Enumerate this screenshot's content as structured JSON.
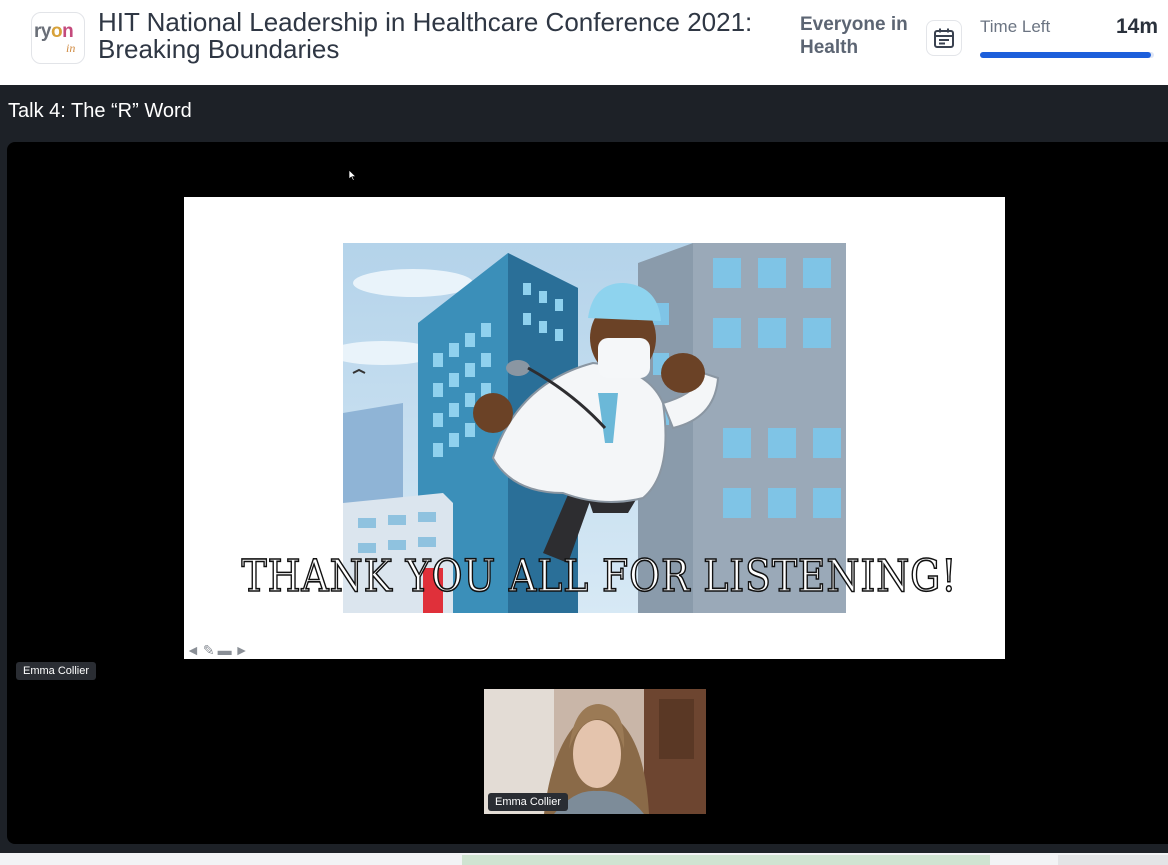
{
  "header": {
    "logo_text": "ryon",
    "logo_sub": "in",
    "conference_title": "HIT National Leadership in Healthcare Conference 2021: Breaking Boundaries",
    "channel_name": "Everyone in Health",
    "calendar_icon": "calendar-icon",
    "time_left_label": "Time Left",
    "time_left_value": "14m",
    "time_left_progress": 0.98
  },
  "talk": {
    "title": "Talk 4: The “R” Word"
  },
  "slide": {
    "caption": "THANK YOU ALL FOR LISTENING!",
    "tool_icons": [
      "prev-arrow-icon",
      "pen-icon",
      "screen-icon",
      "next-arrow-icon"
    ]
  },
  "participants": {
    "presenter_tag": "Emma Collier",
    "video_tag": "Emma Collier"
  },
  "colors": {
    "accent": "#1d5fdb",
    "stage_bg": "#000000",
    "app_bg": "#1d2127"
  }
}
